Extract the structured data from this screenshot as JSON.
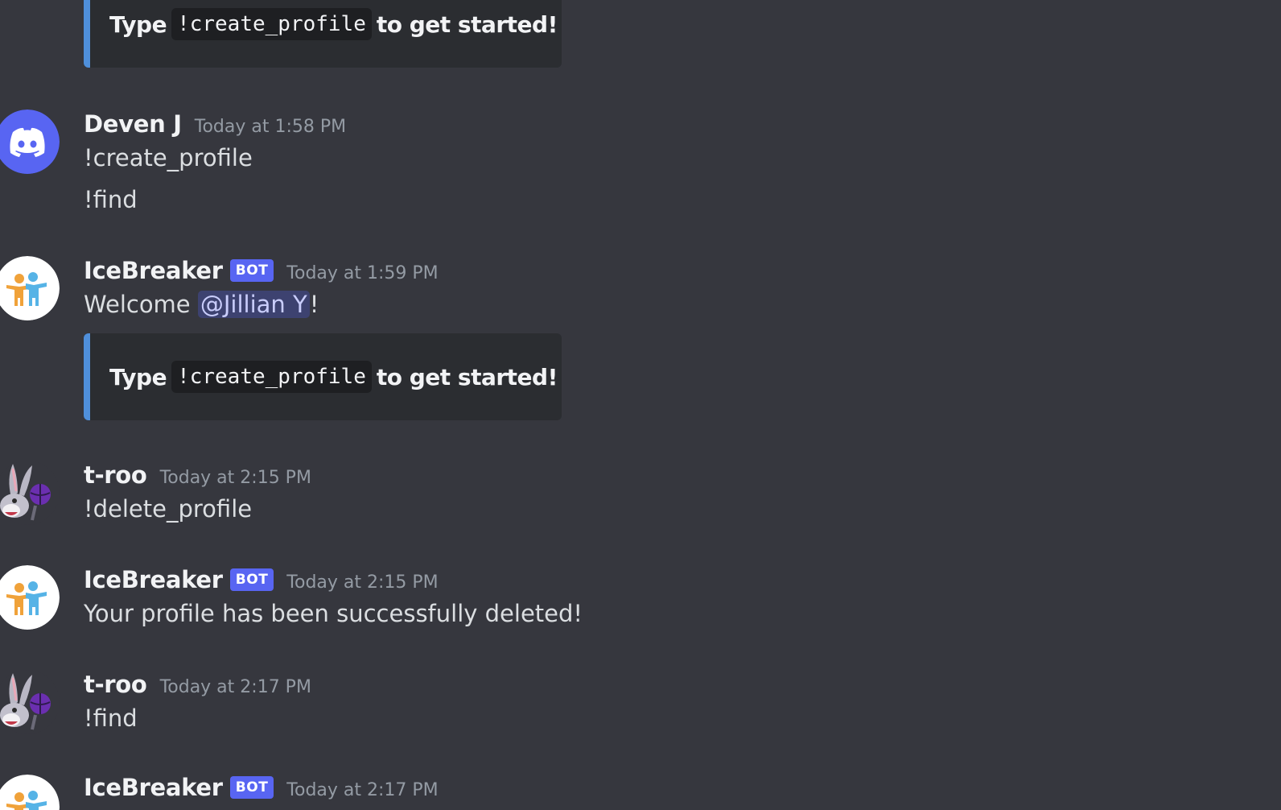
{
  "embed_top": {
    "prefix": "Type",
    "code": "!create_profile",
    "suffix": "to get started!"
  },
  "messages": [
    {
      "author": "Deven J",
      "timestamp": "Today at 1:58 PM",
      "lines": [
        "!create_profile",
        "!find"
      ]
    },
    {
      "author": "IceBreaker",
      "bot_tag": "BOT",
      "timestamp": "Today at 1:59 PM",
      "welcome_prefix": "Welcome ",
      "mention": "@Jillian Y",
      "welcome_suffix": "!",
      "embed": {
        "prefix": "Type",
        "code": "!create_profile",
        "suffix": "to get started!"
      }
    },
    {
      "author": "t-roo",
      "timestamp": "Today at 2:15 PM",
      "lines": [
        "!delete_profile"
      ]
    },
    {
      "author": "IceBreaker",
      "bot_tag": "BOT",
      "timestamp": "Today at 2:15 PM",
      "lines": [
        "Your profile has been successfully deleted!"
      ]
    },
    {
      "author": "t-roo",
      "timestamp": "Today at 2:17 PM",
      "lines": [
        "!find"
      ]
    },
    {
      "author": "IceBreaker",
      "bot_tag": "BOT",
      "timestamp": "Today at 2:17 PM"
    }
  ],
  "avatars": {
    "deven": "discord-logo-icon",
    "icebreaker": "icebreaker-logo-icon",
    "troo": "bunny-basketball-icon"
  },
  "colors": {
    "background": "#36373e",
    "bot_tag": "#5865f2",
    "embed_bar": "#4f8fdb",
    "embed_bg": "#2b2d31",
    "discord_blurple": "#5865f2"
  }
}
